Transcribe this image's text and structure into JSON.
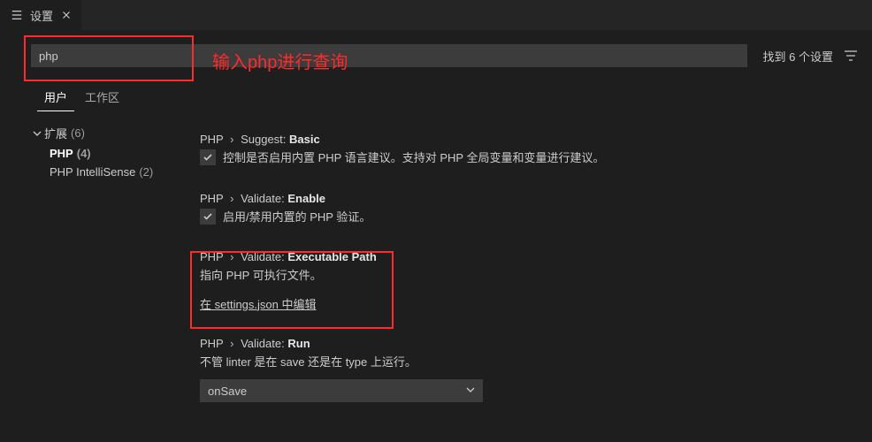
{
  "tab": {
    "title": "设置"
  },
  "search": {
    "value": "php",
    "result_count": "找到 6 个设置"
  },
  "annotation": {
    "search_label": "输入php进行查询"
  },
  "scope_tabs": {
    "user": "用户",
    "workspace": "工作区"
  },
  "sidebar": {
    "extensions_label": "扩展",
    "extensions_count": "(6)",
    "php_label": "PHP",
    "php_count": "(4)",
    "intellisense_label": "PHP IntelliSense",
    "intellisense_count": "(2)"
  },
  "settings": {
    "suggest_basic": {
      "category": "PHP",
      "sub": "Suggest:",
      "name": "Basic",
      "desc": "控制是否启用内置 PHP 语言建议。支持对 PHP 全局变量和变量进行建议。"
    },
    "validate_enable": {
      "category": "PHP",
      "sub": "Validate:",
      "name": "Enable",
      "desc": "启用/禁用内置的 PHP 验证。"
    },
    "validate_exec": {
      "category": "PHP",
      "sub": "Validate:",
      "name": "Executable Path",
      "desc": "指向 PHP 可执行文件。",
      "link": "在 settings.json 中编辑"
    },
    "validate_run": {
      "category": "PHP",
      "sub": "Validate:",
      "name": "Run",
      "desc": "不管 linter 是在 save 还是在 type 上运行。",
      "value": "onSave"
    }
  }
}
